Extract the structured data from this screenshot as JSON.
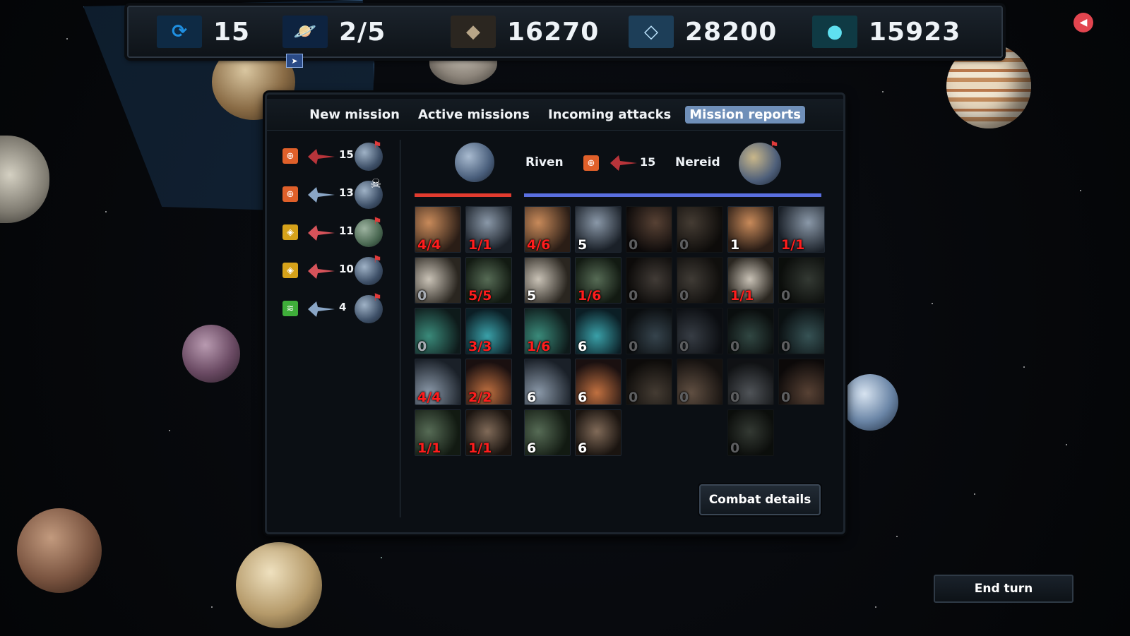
{
  "resources": [
    {
      "name": "turn-icon",
      "glyph": "⟳",
      "value": "15",
      "color": "#1f8fe0"
    },
    {
      "name": "planets-icon",
      "glyph": "🪐",
      "value": "2/5",
      "color": "#2a6fd0"
    },
    {
      "name": "ore-icon",
      "glyph": "◆",
      "value": "16270",
      "color": "#7a6d5c"
    },
    {
      "name": "crystal-icon",
      "glyph": "◇",
      "value": "28200",
      "color": "#7fc6e6"
    },
    {
      "name": "gas-icon",
      "glyph": "●",
      "value": "15923",
      "color": "#2fb3c9"
    }
  ],
  "tabs": [
    {
      "label": "New mission",
      "active": false
    },
    {
      "label": "Active missions",
      "active": false
    },
    {
      "label": "Incoming attacks",
      "active": false
    },
    {
      "label": "Mission reports",
      "active": true
    }
  ],
  "missions": [
    {
      "type_icon": "target-icon",
      "type_color": "#e0602a",
      "ship_color": "#b8343a",
      "count": "15",
      "planet": "blue",
      "marker": "flag"
    },
    {
      "type_icon": "target-icon",
      "type_color": "#e0602a",
      "ship_color": "#8aa6c6",
      "count": "13",
      "planet": "blue",
      "marker": "skull"
    },
    {
      "type_icon": "shield-icon",
      "type_color": "#d6a21a",
      "ship_color": "#d6535a",
      "count": "11",
      "planet": "green",
      "marker": "flag"
    },
    {
      "type_icon": "shield-icon",
      "type_color": "#d6a21a",
      "ship_color": "#d6535a",
      "count": "10",
      "planet": "blue",
      "marker": "flag"
    },
    {
      "type_icon": "transport-icon",
      "type_color": "#3fae3a",
      "ship_color": "#8aa6c6",
      "count": "4",
      "planet": "blue",
      "marker": "flag"
    }
  ],
  "report": {
    "attacker_name": "Riven",
    "defender_name": "Nereid",
    "fleet_count": "15",
    "attacker_units": [
      [
        "4/4",
        "1/1"
      ],
      [
        "0",
        "5/5"
      ],
      [
        "0",
        "3/3"
      ],
      [
        "4/4",
        "2/2"
      ],
      [
        "1/1",
        "1/1"
      ]
    ],
    "defender_units": [
      [
        "4/6",
        "5",
        "0",
        "0",
        "1",
        "1/1"
      ],
      [
        "5",
        "1/6",
        "0",
        "0",
        "1/1",
        "0"
      ],
      [
        "1/6",
        "6",
        "0",
        "0",
        "0",
        "0"
      ],
      [
        "6",
        "6",
        "0",
        "0",
        "0",
        "0"
      ],
      [
        "6",
        "6",
        null,
        null,
        "0",
        null
      ]
    ]
  },
  "buttons": {
    "combat_details": "Combat details",
    "end_turn": "End turn"
  }
}
